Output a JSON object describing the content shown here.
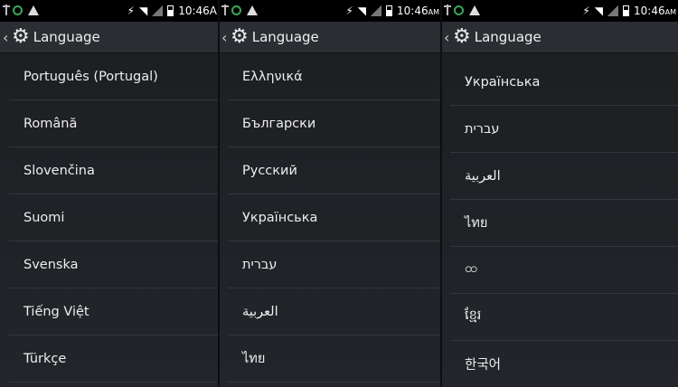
{
  "status": {
    "time": "10:46",
    "time_suffix_1": "A",
    "time_suffix": "AM"
  },
  "title": "Language",
  "panels": [
    {
      "items": [
        "Português (Portugal)",
        "Română",
        "Slovenčina",
        "Suomi",
        "Svenska",
        "Tiếng Việt",
        "Türkçe"
      ]
    },
    {
      "items": [
        "Ελληνικά",
        "Български",
        "Русский",
        "Українська",
        "עברית",
        "العربية",
        "ไทย"
      ]
    },
    {
      "items": [
        "Українська",
        "עברית",
        "العربية",
        "ไทย",
        "ထ",
        "ខ្មែរ",
        "한국어"
      ]
    }
  ]
}
